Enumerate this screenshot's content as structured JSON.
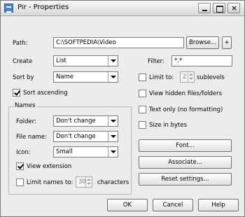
{
  "window": {
    "title": "Pir - Properties"
  },
  "path": {
    "label": "Path:",
    "value": "C:\\SOFTPEDIA\\Video",
    "browse_label": "Browse...",
    "add_label": "+"
  },
  "create": {
    "label": "Create",
    "value": "List"
  },
  "sort_by": {
    "label": "Sort by",
    "value": "Name"
  },
  "sort_ascending": {
    "label": "Sort ascending",
    "checked": true
  },
  "filter": {
    "label": "Filter:",
    "value": "*.*"
  },
  "limit_to": {
    "label": "Limit to:",
    "value": "2",
    "suffix": "sublevels",
    "checked": false
  },
  "options": {
    "view_hidden": "View hidden files/folders",
    "text_only": "Text only (no formatting)",
    "size_in_bytes": "Size in bytes"
  },
  "names_group": {
    "title": "Names",
    "folder_label": "Folder:",
    "folder_value": "Don't change",
    "file_name_label": "File name:",
    "file_name_value": "Don't change",
    "icon_label": "Icon:",
    "icon_value": "Small",
    "view_extension": "View extension",
    "view_extension_checked": true,
    "limit_names_label": "Limit names to:",
    "limit_names_value": "30",
    "limit_names_suffix": "characters",
    "limit_names_checked": false
  },
  "side_buttons": {
    "font": "Font...",
    "associate": "Associate...",
    "reset": "Reset settings..."
  },
  "footer": {
    "ok": "OK",
    "cancel": "Cancel",
    "help": "Help"
  }
}
